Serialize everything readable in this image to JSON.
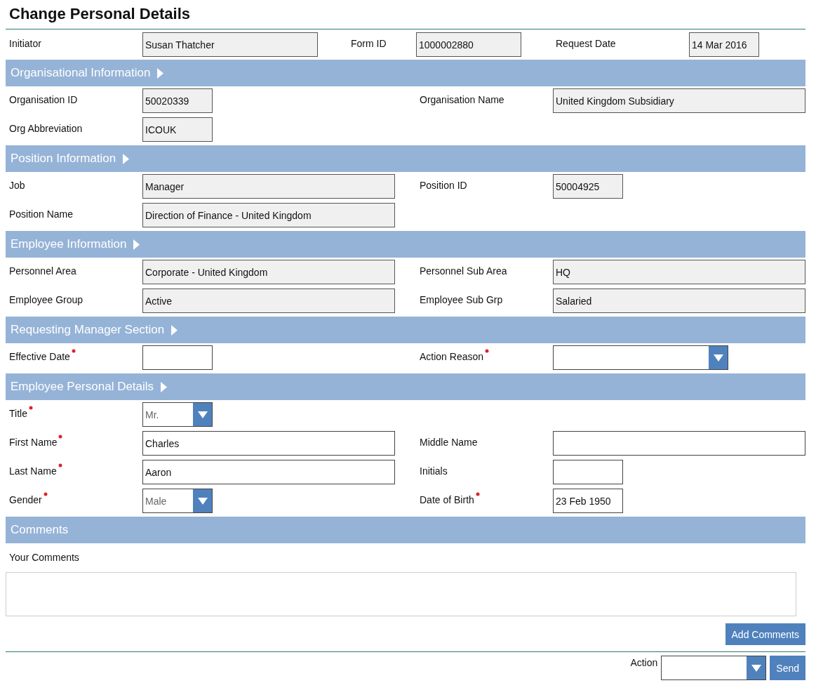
{
  "title": "Change Personal Details",
  "header_fields": [
    {
      "label": "Initiator",
      "kind": "long",
      "readonly": true,
      "value": "Susan Thatcher",
      "required": false
    },
    {
      "label": "Form ID",
      "kind": "medium",
      "readonly": true,
      "value": "1000002880",
      "required": false
    },
    {
      "label": "Request Date",
      "kind": "short",
      "readonly": true,
      "value": "14 Mar 2016",
      "required": false
    }
  ],
  "sections": [
    {
      "title": "Organisational Information",
      "expander": true,
      "rows": [
        [
          {
            "label": "Organisation ID",
            "kind": "short",
            "readonly": true,
            "value": "50020339",
            "required": false
          },
          {
            "label": "Organisation Name",
            "kind": "full",
            "readonly": true,
            "value": "United Kingdom Subsidiary",
            "required": false
          }
        ],
        [
          {
            "label": "Org Abbreviation",
            "kind": "short",
            "readonly": true,
            "value": "ICOUK",
            "required": false
          }
        ]
      ]
    },
    {
      "title": "Position Information",
      "expander": true,
      "rows": [
        [
          {
            "label": "Job",
            "kind": "full",
            "readonly": true,
            "value": "Manager",
            "required": false
          },
          {
            "label": "Position ID",
            "kind": "short",
            "readonly": true,
            "value": "50004925",
            "required": false
          }
        ],
        [
          {
            "label": "Position Name",
            "kind": "full",
            "readonly": true,
            "value": "Direction of Finance - United Kingdom",
            "required": false
          }
        ]
      ]
    },
    {
      "title": "Employee Information",
      "expander": true,
      "rows": [
        [
          {
            "label": "Personnel Area",
            "kind": "full",
            "readonly": true,
            "value": "Corporate - United Kingdom",
            "required": false
          },
          {
            "label": "Personnel Sub Area",
            "kind": "full",
            "readonly": true,
            "value": "HQ",
            "required": false
          }
        ],
        [
          {
            "label": "Employee Group",
            "kind": "full",
            "readonly": true,
            "value": "Active",
            "required": false
          },
          {
            "label": "Employee Sub Grp",
            "kind": "full",
            "readonly": true,
            "value": "Salaried",
            "required": false
          }
        ]
      ]
    },
    {
      "title": "Requesting Manager Section",
      "expander": true,
      "rows": [
        [
          {
            "label": "Effective Date",
            "kind": "short",
            "readonly": false,
            "required": true
          },
          {
            "label": "Action Reason",
            "kind": "combobox",
            "readonly": false,
            "required": true
          }
        ]
      ]
    },
    {
      "title": "Employee Personal Details",
      "expander": true,
      "rows": [
        [
          {
            "label": "Title",
            "kind": "dropdown",
            "readonly": false,
            "value": "Mr.",
            "required": true
          }
        ],
        [
          {
            "label": "First Name",
            "kind": "full",
            "readonly": false,
            "value": "Charles",
            "required": true
          },
          {
            "label": "Middle Name",
            "kind": "full",
            "readonly": false,
            "required": false
          }
        ],
        [
          {
            "label": "Last Name",
            "kind": "full",
            "readonly": false,
            "value": "Aaron",
            "required": true
          },
          {
            "label": "Initials",
            "kind": "short",
            "readonly": false,
            "required": false
          }
        ],
        [
          {
            "label": "Gender",
            "kind": "dropdown",
            "readonly": false,
            "value": "Male",
            "required": true
          },
          {
            "label": "Date of Birth",
            "kind": "short",
            "readonly": false,
            "value": "23 Feb 1950",
            "required": true
          }
        ]
      ]
    },
    {
      "title": "Comments",
      "expander": false
    }
  ],
  "comments": {
    "label": "Your Comments",
    "button": "Add Comments"
  },
  "footer": {
    "action_label": "Action",
    "send_button": "Send"
  }
}
